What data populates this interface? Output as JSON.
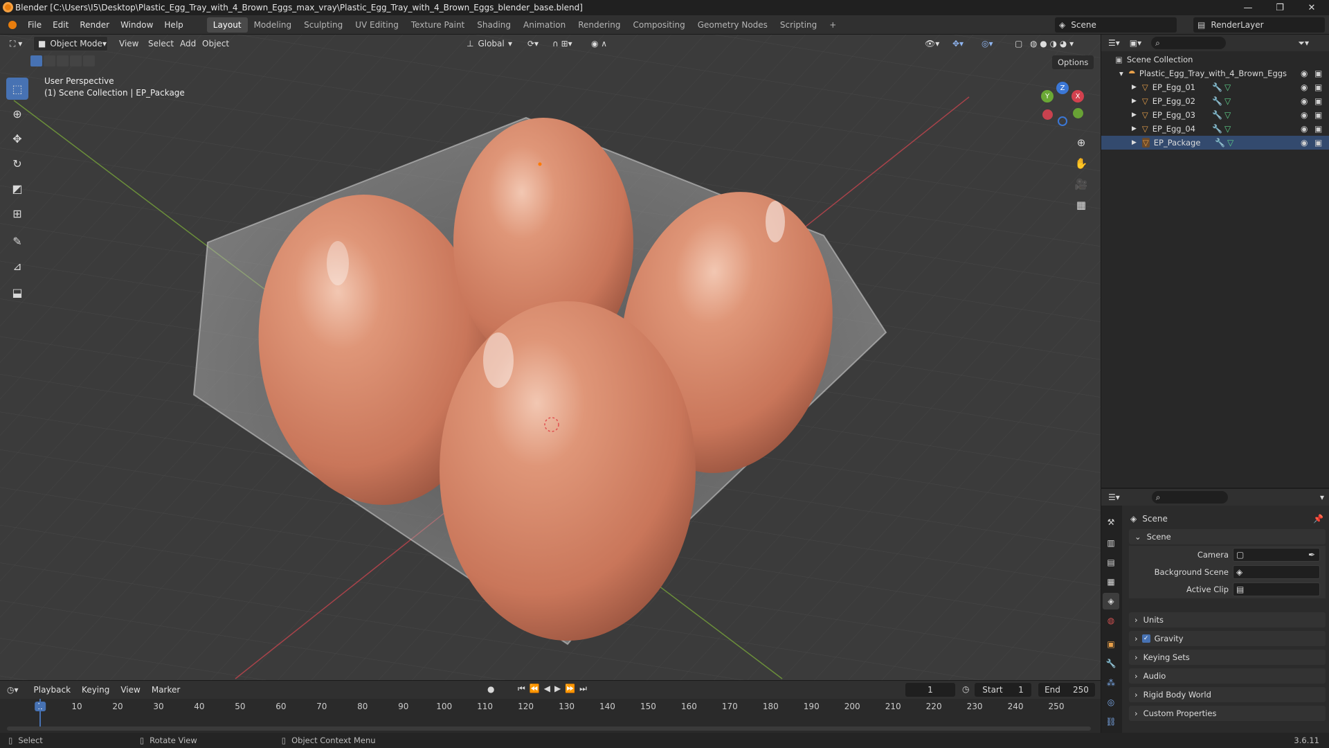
{
  "window": {
    "title": "Blender [C:\\Users\\I5\\Desktop\\Plastic_Egg_Tray_with_4_Brown_Eggs_max_vray\\Plastic_Egg_Tray_with_4_Brown_Eggs_blender_base.blend]",
    "minimize": "—",
    "maximize": "❐",
    "close": "✕"
  },
  "menu": [
    "File",
    "Edit",
    "Render",
    "Window",
    "Help"
  ],
  "workspaces": [
    "Layout",
    "Modeling",
    "Sculpting",
    "UV Editing",
    "Texture Paint",
    "Shading",
    "Animation",
    "Rendering",
    "Compositing",
    "Geometry Nodes",
    "Scripting",
    "+"
  ],
  "active_workspace": "Layout",
  "scene_selector": "Scene",
  "view_layer": "RenderLayer",
  "viewport": {
    "mode": "Object Mode",
    "menus": [
      "View",
      "Select",
      "Add",
      "Object"
    ],
    "transform_orientation": "Global",
    "options": "Options",
    "perspective_label": "User Perspective",
    "collection_label": "(1) Scene Collection | EP_Package",
    "gizmo_axes": [
      "X",
      "Y",
      "Z"
    ]
  },
  "outliner": {
    "root": "Scene Collection",
    "collection": "Plastic_Egg_Tray_with_4_Brown_Eggs",
    "objects": [
      "EP_Egg_01",
      "EP_Egg_02",
      "EP_Egg_03",
      "EP_Egg_04",
      "EP_Package"
    ]
  },
  "properties": {
    "breadcrumb": "Scene",
    "panel_title": "Scene",
    "fields": {
      "camera": "Camera",
      "background_scene": "Background Scene",
      "active_clip": "Active Clip"
    },
    "sections": [
      "Units",
      "Gravity",
      "Keying Sets",
      "Audio",
      "Rigid Body World",
      "Custom Properties"
    ],
    "gravity_checked": true
  },
  "timeline": {
    "menus": [
      "Playback",
      "Keying",
      "View",
      "Marker"
    ],
    "current_frame": "1",
    "start_label": "Start",
    "start": "1",
    "end_label": "End",
    "end": "250",
    "ticks": [
      "1",
      "10",
      "20",
      "30",
      "40",
      "50",
      "60",
      "70",
      "80",
      "90",
      "100",
      "110",
      "120",
      "130",
      "140",
      "150",
      "160",
      "170",
      "180",
      "190",
      "200",
      "210",
      "220",
      "230",
      "240",
      "250"
    ]
  },
  "statusbar": {
    "select": "Select",
    "rotate": "Rotate View",
    "context_menu": "Object Context Menu",
    "version": "3.6.11"
  },
  "colors": {
    "accent": "#4772b3",
    "object_orange": "#e8a04a",
    "mesh_green": "#5fd08a",
    "modifier_blue": "#7aa8e8",
    "egg": "#d98a6a"
  },
  "icons": {
    "select-box": "arrow",
    "cursor": "crosshair",
    "move": "arrows",
    "rotate": "circular-arrow",
    "scale": "square",
    "transform": "compound",
    "annotate": "pencil",
    "measure": "ruler",
    "add-cube": "cube"
  }
}
